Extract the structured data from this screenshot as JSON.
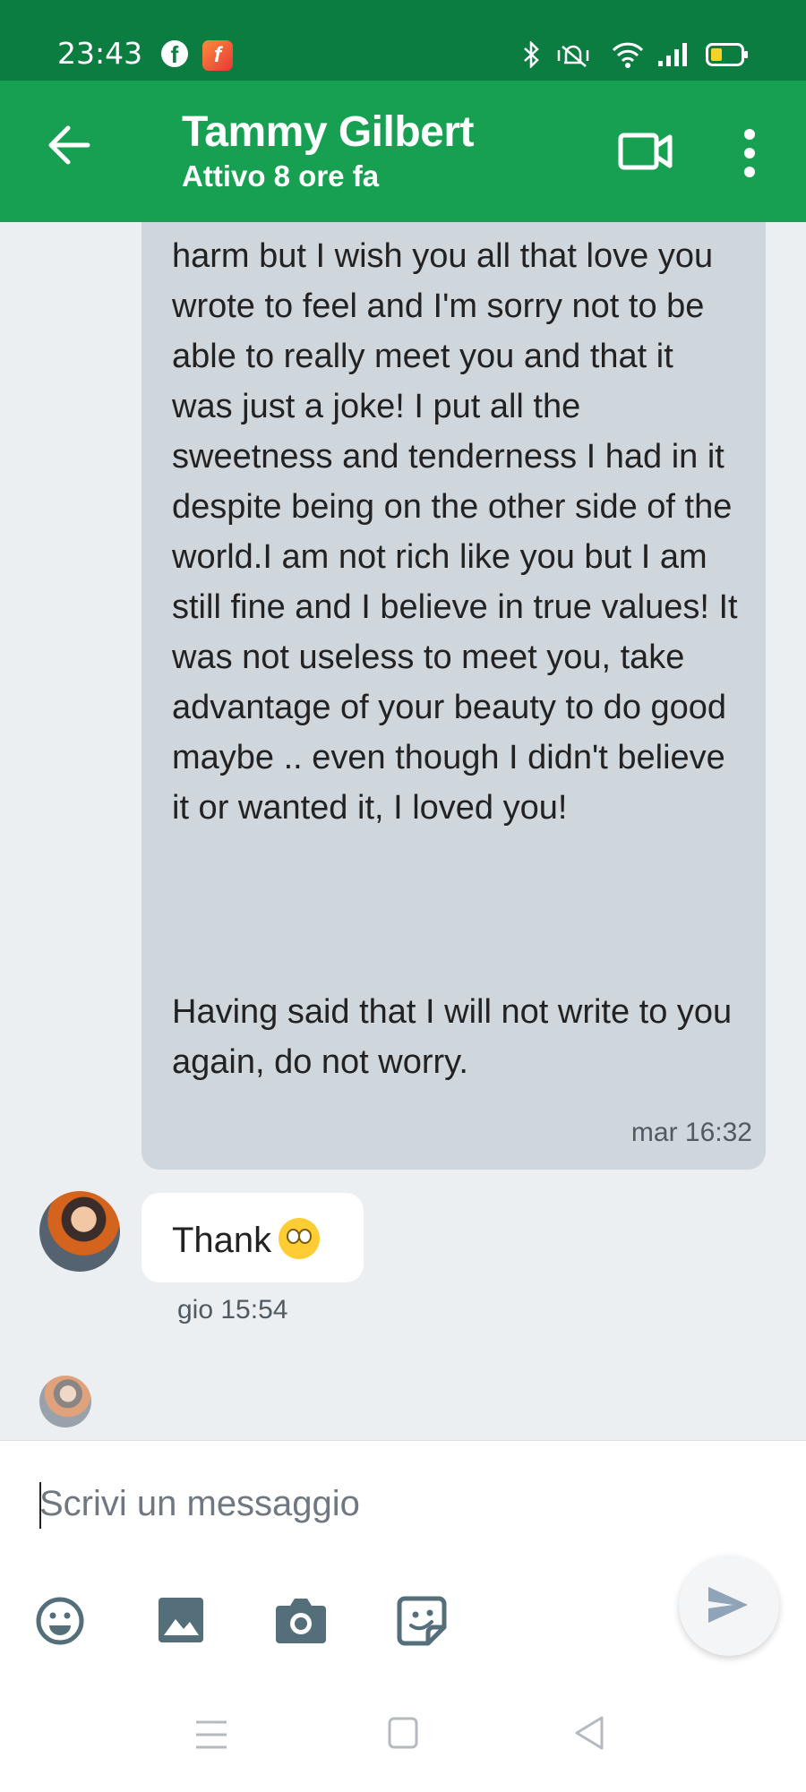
{
  "status_bar": {
    "time": "23:43",
    "icons": [
      "facebook-icon",
      "flash-app-icon",
      "bluetooth-icon",
      "silent-vibrate-icon",
      "wifi-icon",
      "signal-icon",
      "battery-icon"
    ]
  },
  "header": {
    "name": "Tammy Gilbert",
    "status": "Attivo 8 ore fa"
  },
  "messages": [
    {
      "text": "harm but I wish you all that love you wrote to feel and I'm sorry not to be able to really meet you and that it was just a joke! I put all the sweetness and tenderness I had in it despite being on the other side of the world.I am not rich like you but I am still fine and I believe in true values! It was not useless to meet you, take advantage of your beauty to do good maybe .. even though I didn't believe it or wanted it, I loved you!"
    },
    {
      "text": "Having said that I will not write to you again, do not worry."
    },
    {
      "timestamp": "mar 16:32"
    },
    {
      "text": "Thank"
    },
    {
      "timestamp": "gio 15:54"
    }
  ],
  "composer": {
    "placeholder": "Scrivi un messaggio"
  },
  "colors": {
    "status_bar": "#0b7d41",
    "app_bar": "#18a052",
    "outgoing_bubble": "#cfd6dc",
    "incoming_bubble": "#ffffff",
    "background": "#eceff2"
  }
}
